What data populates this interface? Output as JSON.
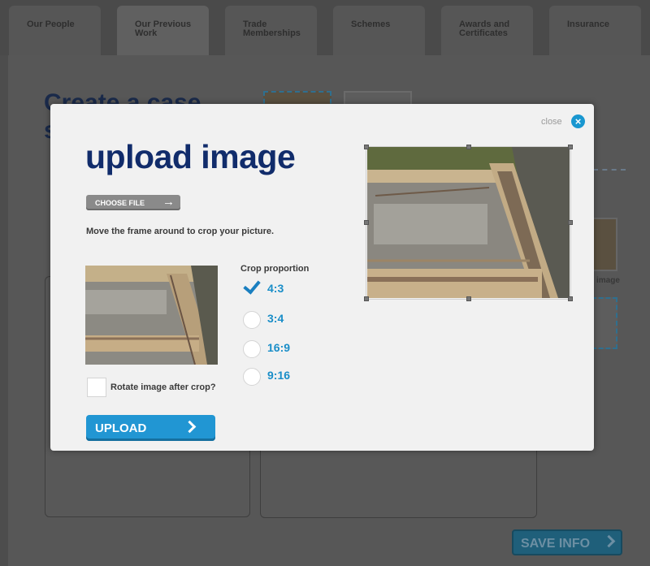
{
  "tabs": [
    {
      "label": "Our People"
    },
    {
      "label": "Our Previous\nWork"
    },
    {
      "label": "Trade\nMemberships"
    },
    {
      "label": "Schemes"
    },
    {
      "label": "Awards and\nCertificates"
    },
    {
      "label": "Insurance"
    }
  ],
  "background": {
    "title": "Create a case\nstudy",
    "save_label": "SAVE INFO",
    "side_label": "image"
  },
  "modal": {
    "close_label": "close",
    "heading": "upload image",
    "choose_file_label": "CHOOSE FILE",
    "instruction": "Move the frame around to crop your picture.",
    "crop_title": "Crop proportion",
    "options": [
      {
        "label": "4:3",
        "checked": true
      },
      {
        "label": "3:4",
        "checked": false
      },
      {
        "label": "16:9",
        "checked": false
      },
      {
        "label": "9:16",
        "checked": false
      }
    ],
    "rotate_label": "Rotate image after crop?",
    "upload_label": "UPLOAD"
  },
  "colors": {
    "accent": "#1997d0",
    "heading": "#112c6b",
    "overlay": "#4d4d4d"
  }
}
